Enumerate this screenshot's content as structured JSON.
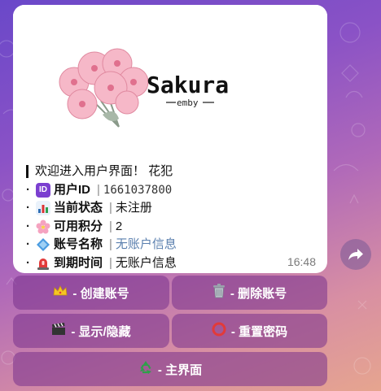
{
  "banner": {
    "brand": "Sakura",
    "sub": "emby"
  },
  "message": {
    "welcome": "欢迎进入用户界面！ 花犯",
    "rows": [
      {
        "icon": "id-icon",
        "label": "用户ID",
        "value": "1661037800"
      },
      {
        "icon": "bar-chart-icon",
        "label": "当前状态",
        "value": "未注册"
      },
      {
        "icon": "blossom-icon",
        "label": "可用积分",
        "value": "2"
      },
      {
        "icon": "diamond-icon",
        "label": "账号名称",
        "value": "无账户信息"
      },
      {
        "icon": "siren-icon",
        "label": "到期时间",
        "value": "无账户信息"
      }
    ],
    "time": "16:48"
  },
  "buttons": {
    "create": "- 创建账号",
    "delete": "- 删除账号",
    "toggle": "- 显示/隐藏",
    "reset": "- 重置密码",
    "home": "- 主界面"
  },
  "colors": {
    "id_icon": "#7b3fd0",
    "chart_icon": "#2f6fb5",
    "diamond_icon": "#4a9be0",
    "siren_icon": "#e23a3a",
    "button_bg": "#8a3a90"
  }
}
